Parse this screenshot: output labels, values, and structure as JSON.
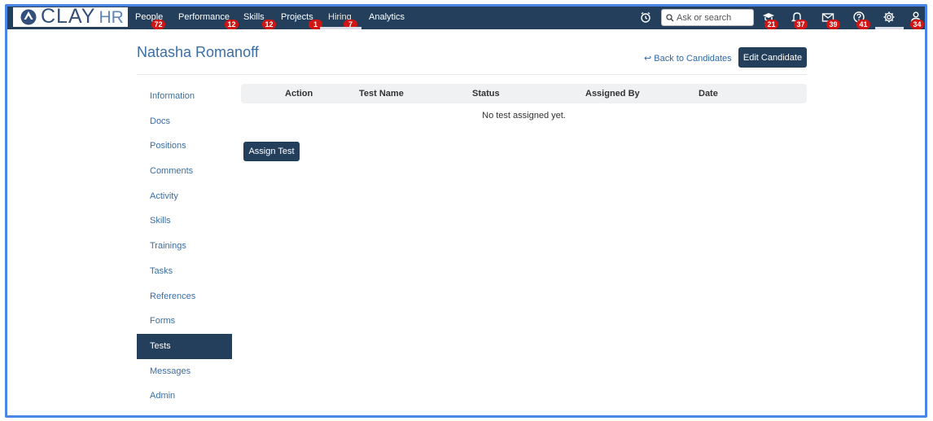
{
  "brand": {
    "logo_main": "CLAY",
    "logo_suffix": "HR"
  },
  "nav": {
    "items": [
      {
        "label": "People",
        "badge": "72"
      },
      {
        "label": "Performance",
        "badge": "12"
      },
      {
        "label": "Skills",
        "badge": "12"
      },
      {
        "label": "Projects",
        "badge": "1"
      },
      {
        "label": "Hiring",
        "badge": "7"
      },
      {
        "label": "Analytics",
        "badge": ""
      }
    ],
    "active": "Hiring"
  },
  "search": {
    "placeholder": "Ask or search"
  },
  "top_icons": [
    {
      "icon": "alarm-clock-icon",
      "badge": ""
    },
    {
      "icon": "learning-icon",
      "badge": "21"
    },
    {
      "icon": "bell-icon",
      "badge": "37"
    },
    {
      "icon": "mail-icon",
      "badge": "39"
    },
    {
      "icon": "help-icon",
      "badge": "41"
    },
    {
      "icon": "gear-icon",
      "badge": ""
    },
    {
      "icon": "user-icon",
      "badge": "34"
    }
  ],
  "page": {
    "title": "Natasha Romanoff",
    "back_label": "Back to Candidates",
    "edit_label": "Edit Candidate"
  },
  "sidebar": {
    "items": [
      "Information",
      "Docs",
      "Positions",
      "Comments",
      "Activity",
      "Skills",
      "Trainings",
      "Tasks",
      "References",
      "Forms",
      "Tests",
      "Messages",
      "Admin"
    ],
    "active": "Tests"
  },
  "tests_table": {
    "columns": [
      "Action",
      "Test Name",
      "Status",
      "Assigned By",
      "Date"
    ],
    "empty_message": "No test assigned yet."
  },
  "assign_label": "Assign Test",
  "colors": {
    "nav_bg": "#243f5c",
    "badge": "#d11414",
    "link": "#2f69a8",
    "frame": "#4a86e8"
  }
}
